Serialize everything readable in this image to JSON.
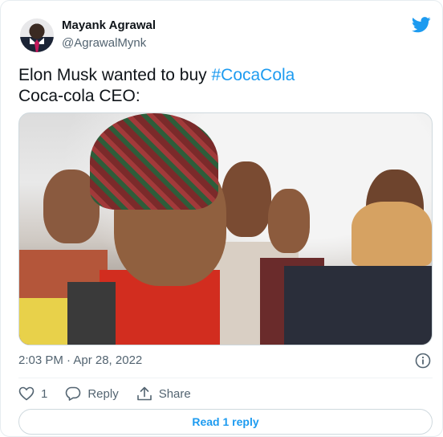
{
  "author": {
    "name": "Mayank Agrawal",
    "handle": "@AgrawalMynk"
  },
  "tweet": {
    "text_prefix": "Elon Musk wanted to buy ",
    "hashtag": "#CocaCola",
    "line2": "Coca-cola CEO:"
  },
  "meta": {
    "timestamp": "2:03 PM · Apr 28, 2022"
  },
  "actions": {
    "like_count": "1",
    "reply_label": "Reply",
    "share_label": "Share"
  },
  "read_replies_label": "Read 1 reply",
  "colors": {
    "accent": "#1d9bf0",
    "secondary_text": "#536471",
    "primary_text": "#0f1419"
  },
  "icons": [
    "twitter-bird-icon",
    "info-icon",
    "heart-icon",
    "reply-icon",
    "share-icon"
  ]
}
